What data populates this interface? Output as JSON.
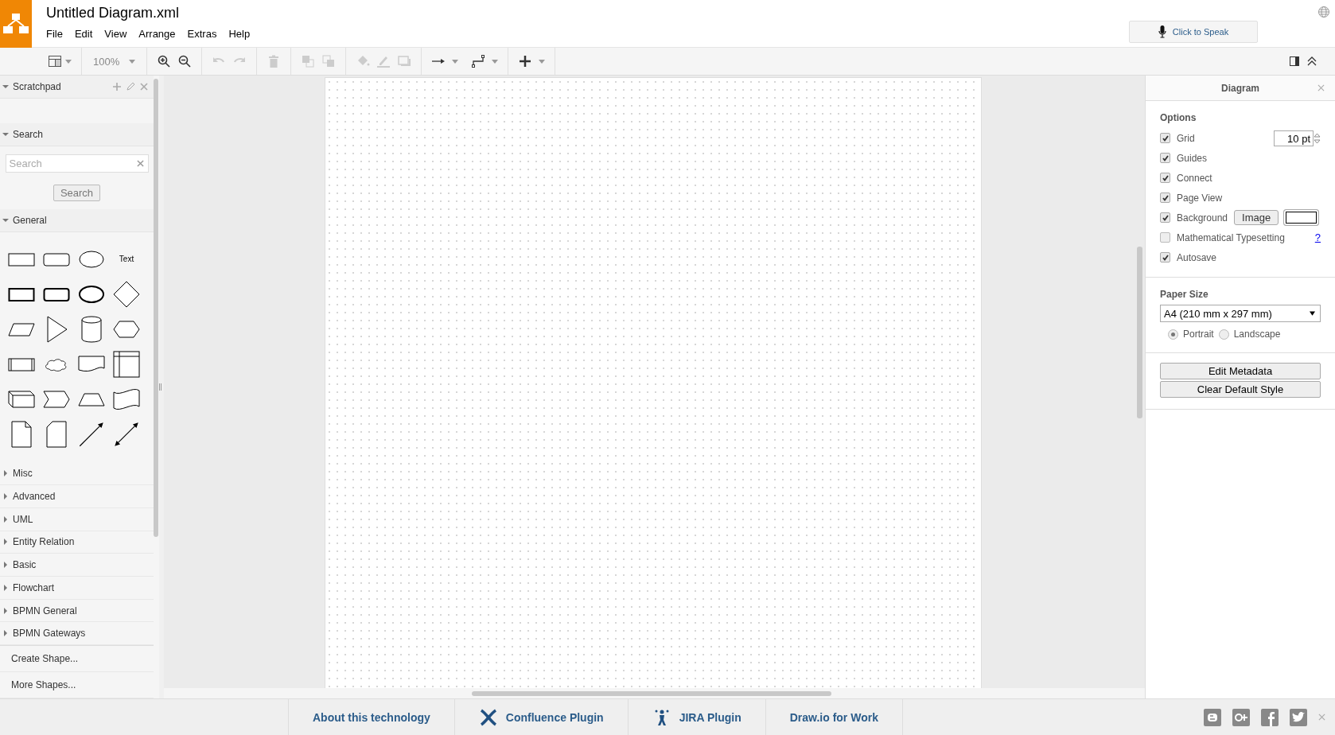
{
  "header": {
    "title": "Untitled Diagram.xml",
    "menu": [
      "File",
      "Edit",
      "View",
      "Arrange",
      "Extras",
      "Help"
    ],
    "speak_button": "Click to Speak"
  },
  "toolbar": {
    "zoom": "100%"
  },
  "sidebar": {
    "sections": [
      {
        "kind": "scratchpad",
        "title": "Scratchpad",
        "expanded": true
      },
      {
        "kind": "search",
        "title": "Search",
        "expanded": true,
        "placeholder": "Search",
        "button": "Search"
      },
      {
        "kind": "shapes",
        "title": "General",
        "expanded": true,
        "shapes": [
          {
            "kind": "rect"
          },
          {
            "kind": "round"
          },
          {
            "kind": "ellipse"
          },
          {
            "kind": "text",
            "label": "Text"
          },
          {
            "kind": "rect-bold"
          },
          {
            "kind": "round-bold"
          },
          {
            "kind": "ellipse-bold"
          },
          {
            "kind": "diamond"
          },
          {
            "kind": "parallelogram"
          },
          {
            "kind": "triangle"
          },
          {
            "kind": "cylinder"
          },
          {
            "kind": "hexagon"
          },
          {
            "kind": "process"
          },
          {
            "kind": "cloud"
          },
          {
            "kind": "document"
          },
          {
            "kind": "internal-storage"
          },
          {
            "kind": "cube"
          },
          {
            "kind": "step"
          },
          {
            "kind": "trapezoid"
          },
          {
            "kind": "tape"
          },
          {
            "kind": "note"
          },
          {
            "kind": "card"
          },
          {
            "kind": "arrow"
          },
          {
            "kind": "double-arrow"
          }
        ]
      },
      {
        "kind": "plain",
        "title": "Misc",
        "expanded": false
      },
      {
        "kind": "plain",
        "title": "Advanced",
        "expanded": false
      },
      {
        "kind": "plain",
        "title": "UML",
        "expanded": false
      },
      {
        "kind": "plain",
        "title": "Entity Relation",
        "expanded": false
      },
      {
        "kind": "plain",
        "title": "Basic",
        "expanded": false
      },
      {
        "kind": "plain",
        "title": "Flowchart",
        "expanded": false
      },
      {
        "kind": "plain",
        "title": "BPMN General",
        "expanded": false
      },
      {
        "kind": "plain",
        "title": "BPMN Gateways",
        "expanded": false
      }
    ],
    "footer_links": [
      "Create Shape...",
      "More Shapes..."
    ]
  },
  "panel": {
    "title": "Diagram",
    "options_title": "Options",
    "options": [
      {
        "label": "Grid",
        "checked": true,
        "value": "10 pt"
      },
      {
        "label": "Guides",
        "checked": true
      },
      {
        "label": "Connect",
        "checked": true
      },
      {
        "label": "Page View",
        "checked": true
      },
      {
        "label": "Background",
        "checked": true,
        "button": "Image"
      },
      {
        "label": "Mathematical Typesetting",
        "checked": false,
        "help": "?"
      },
      {
        "label": "Autosave",
        "checked": true
      }
    ],
    "paper_title": "Paper Size",
    "paper": "A4 (210 mm x 297 mm)",
    "orientations": [
      {
        "label": "Portrait",
        "selected": true
      },
      {
        "label": "Landscape",
        "selected": false
      }
    ],
    "buttons": [
      "Edit Metadata",
      "Clear Default Style"
    ]
  },
  "footer": {
    "links": [
      "About this technology",
      "Confluence Plugin",
      "JIRA Plugin",
      "Draw.io for Work"
    ]
  }
}
